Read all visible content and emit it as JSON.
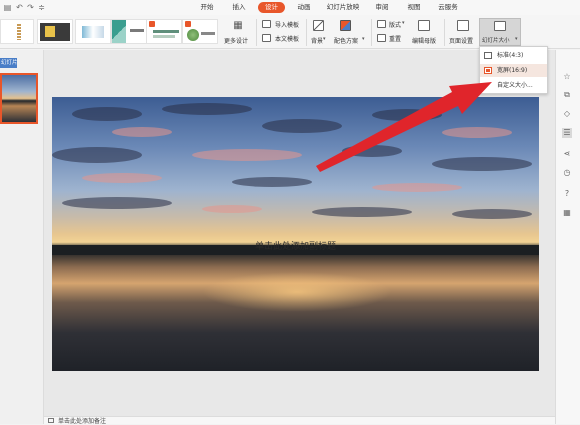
{
  "menu": {
    "tabs": [
      {
        "label": "开始"
      },
      {
        "label": "插入"
      },
      {
        "label": "设计"
      },
      {
        "label": "动画"
      },
      {
        "label": "幻灯片放映"
      },
      {
        "label": "审阅"
      },
      {
        "label": "视图"
      },
      {
        "label": "云服务"
      }
    ],
    "active_tab": "设计"
  },
  "ribbon": {
    "more_designs": "更多设计",
    "import_template": "导入模板",
    "text_template": "本文模板",
    "background": "背景",
    "color_scheme": "配色方案",
    "layout": "版式",
    "reset": "重置",
    "edit_master": "编辑母版",
    "page_setup": "页面设置",
    "slide_size": "幻灯片大小"
  },
  "left_panel": {
    "tab_label": "幻灯片",
    "slide_number": "1"
  },
  "slide": {
    "subtitle_placeholder": "单击此处添加副标题"
  },
  "dropdown": {
    "items": [
      {
        "label": "标准(4:3)"
      },
      {
        "label": "宽屏(16:9)"
      },
      {
        "label": "自定义大小..."
      }
    ],
    "selected_index": 1
  },
  "status": {
    "notes_placeholder": "单击此处添加备注"
  },
  "colors": {
    "accent": "#e8562a",
    "arrow": "#e0252b"
  }
}
